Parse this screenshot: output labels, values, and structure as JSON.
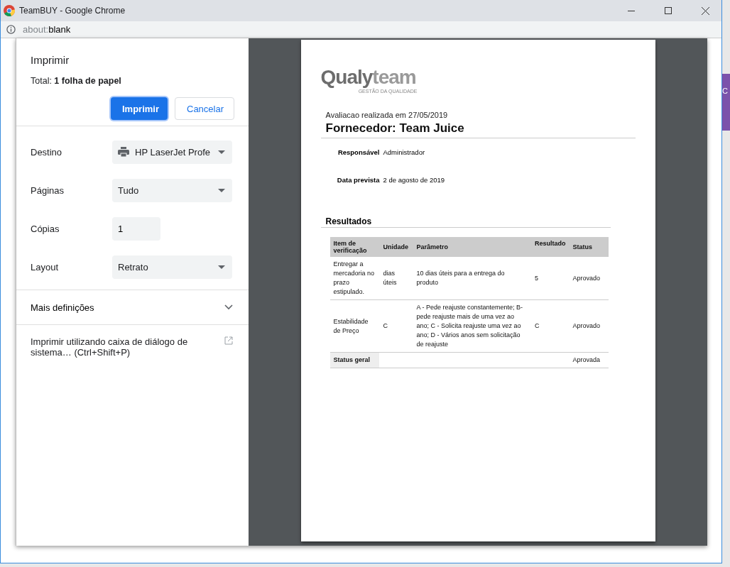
{
  "window": {
    "title": "TeamBUY - Google Chrome"
  },
  "address_bar": {
    "scheme": "about:",
    "path": "blank"
  },
  "background_page": {
    "side_button": "C"
  },
  "print_dialog": {
    "title": "Imprimir",
    "total": "Total: **1 folha de papel**",
    "buttons": [
      {
        "label": "Imprimir",
        "kind": "primary"
      },
      {
        "label": "Cancelar",
        "kind": "secondary"
      }
    ],
    "settings": [
      {
        "label": "Destino",
        "kind": "destination",
        "value": "HP LaserJet Profe"
      },
      {
        "label": "Páginas",
        "kind": "select",
        "value": "Tudo"
      },
      {
        "label": "Cópias",
        "kind": "number",
        "value": "1"
      },
      {
        "label": "Layout",
        "kind": "select",
        "value": "Retrato"
      }
    ],
    "more_settings": {
      "label": "Mais definições",
      "expanded": false
    },
    "system_dialog_link": "Imprimir utilizando caixa de diálogo de sistema… (Ctrl+Shift+P)"
  },
  "preview": {
    "logo": {
      "first": "Qualy",
      "second": "team",
      "tagline": "GESTÃO DA QUALIDADE"
    },
    "subtitle": "Avaliacao realizada em 27/05/2019",
    "heading": "Fornecedor: Team Juice",
    "fields": [
      {
        "label": "Responsável",
        "value": "Administrador"
      },
      {
        "label": "Data prevista",
        "value": "2 de agosto de 2019"
      }
    ],
    "section": "Resultados",
    "table": {
      "columns": [
        "Item de verificação",
        "Unidade",
        "Parâmetro",
        "Resultado",
        "Status"
      ],
      "rows": [
        [
          "Entregar a mercadoria no prazo estipulado.",
          "dias úteis",
          "10 dias úteis para a entrega do produto",
          "5",
          "Aprovado"
        ],
        [
          "Estabilidade de Preço",
          "C",
          "A - Pede reajuste constantemente; B- pede reajuste mais de uma vez ao ano; C - Solicita reajuste uma vez ao ano; D - Vários anos sem solicitação de reajuste",
          "C",
          "Aprovado"
        ]
      ],
      "summary": {
        "label": "Status geral",
        "value": "Aprovada"
      }
    }
  }
}
